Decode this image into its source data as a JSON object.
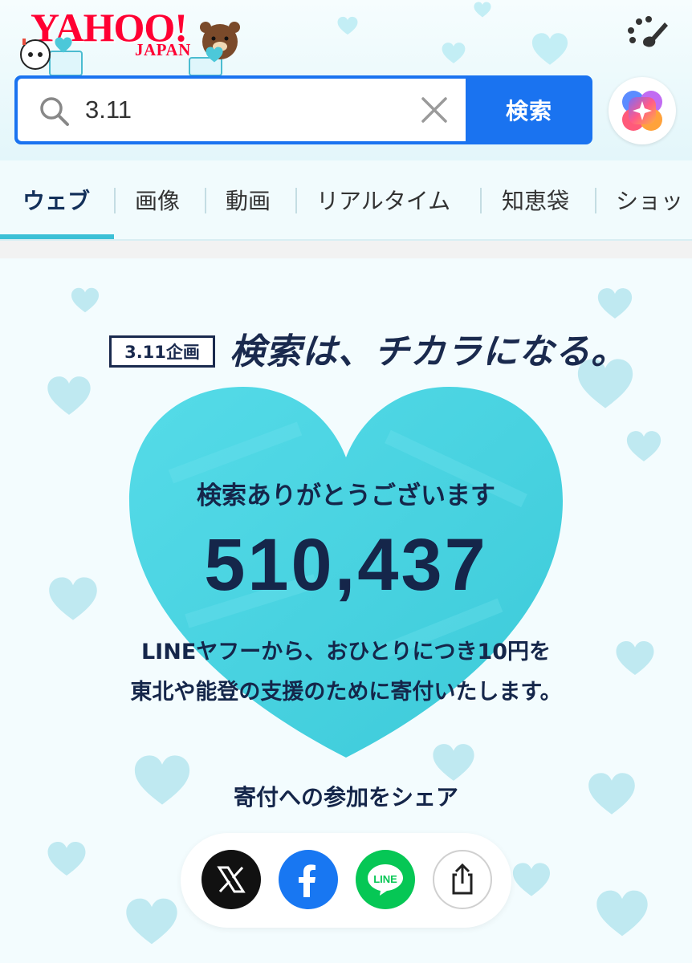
{
  "header": {
    "logo_main": "YAHOO!",
    "logo_sub": "JAPAN"
  },
  "search": {
    "query": "3.11",
    "button_label": "検索"
  },
  "tabs": [
    {
      "label": "ウェブ",
      "active": true
    },
    {
      "label": "画像"
    },
    {
      "label": "動画"
    },
    {
      "label": "リアルタイム"
    },
    {
      "label": "知恵袋"
    },
    {
      "label": "ショッ"
    }
  ],
  "campaign": {
    "badge": "3.11企画",
    "title": "検索は、チカラになる。",
    "thanks": "検索ありがとうございます",
    "count": "510,437",
    "desc_line1": "LINEヤフーから、おひとりにつき10円を",
    "desc_line2": "東北や能登の支援のために寄付いたします。",
    "share_label": "寄付への参加をシェア"
  },
  "share": {
    "buttons": [
      {
        "icon": "x-icon"
      },
      {
        "icon": "facebook-icon"
      },
      {
        "icon": "line-icon",
        "label": "LINE"
      },
      {
        "icon": "share-icon"
      }
    ]
  },
  "colors": {
    "accent_blue": "#1a73f0",
    "heart_cyan": "#44d3e2",
    "navy_text": "#15264a",
    "tab_underline": "#3cc0d6"
  }
}
